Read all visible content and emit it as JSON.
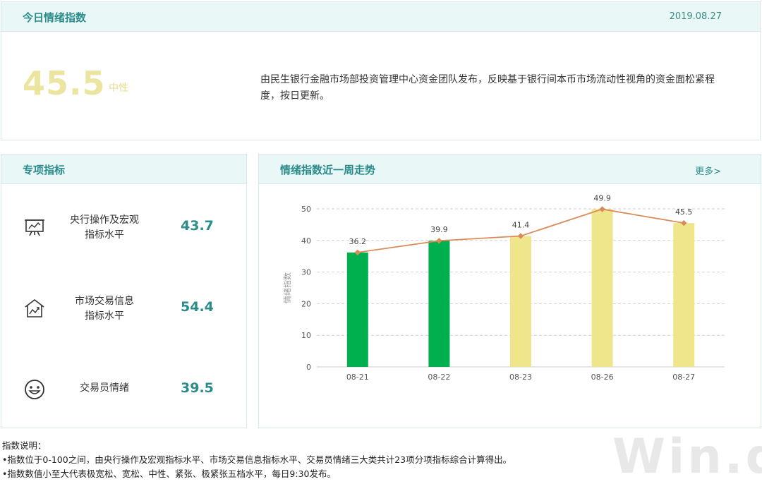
{
  "header": {
    "title": "今日情绪指数",
    "date": "2019.08.27"
  },
  "today": {
    "value": "45.5",
    "level": "中性",
    "description": "由民生银行金融市场部投资管理中心资金团队发布，反映基于银行间本币市场流动性视角的资金面松紧程度，按日更新。"
  },
  "special": {
    "title": "专项指标",
    "items": [
      {
        "line1": "央行操作及宏观",
        "line2": "指标水平",
        "value": "43.7",
        "icon": "presentation-board-icon"
      },
      {
        "line1": "市场交易信息",
        "line2": "指标水平",
        "value": "54.4",
        "icon": "market-house-icon"
      },
      {
        "line1": "交易员情绪",
        "line2": "",
        "value": "39.5",
        "icon": "smiley-face-icon"
      }
    ]
  },
  "trend": {
    "title": "情绪指数近一周走势",
    "more": "更多>"
  },
  "chart_data": {
    "type": "bar",
    "categories": [
      "08-21",
      "08-22",
      "08-23",
      "08-26",
      "08-27"
    ],
    "values": [
      36.2,
      39.9,
      41.4,
      49.9,
      45.5
    ],
    "bar_colors": [
      "#00b04f",
      "#00b04f",
      "#efe68c",
      "#efe68c",
      "#efe68c"
    ],
    "line_color": "#d98c5a",
    "ylabel": "情绪指数",
    "ylim": [
      0,
      50
    ],
    "yticks": [
      0,
      10,
      20,
      30,
      40,
      50
    ],
    "grid": true,
    "overlay_line": true
  },
  "notes": {
    "title": "指数说明：",
    "line1": "•指数位于0-100之间，由央行操作及宏观指标水平、市场交易信息指标水平、交易员情绪三大类共计23项分项指标综合计算得出。",
    "line2": "•指数数值小至大代表极宽松、宽松、中性、紧张、极紧张五档水平，每日9:30发布。"
  },
  "watermark": "Win.d",
  "colors": {
    "accent": "#2b8c8c",
    "header_bg": "#eaf7f7",
    "green": "#00b04f",
    "yellow": "#efe68c"
  }
}
